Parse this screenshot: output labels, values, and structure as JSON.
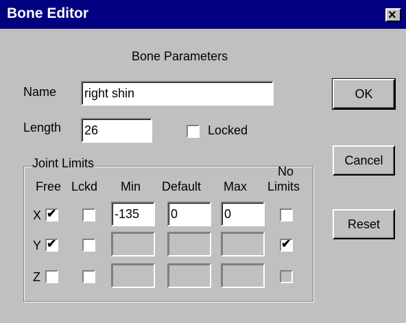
{
  "window": {
    "title": "Bone Editor",
    "close_glyph": "×"
  },
  "header": {
    "section_title": "Bone Parameters"
  },
  "name": {
    "label": "Name",
    "value": "right shin"
  },
  "length": {
    "label": "Length",
    "value": "26"
  },
  "locked": {
    "label": "Locked",
    "checked": false
  },
  "buttons": {
    "ok": "OK",
    "cancel": "Cancel",
    "reset": "Reset"
  },
  "joint_limits": {
    "title": "Joint Limits",
    "headers": {
      "free": "Free",
      "lckd": "Lckd",
      "min": "Min",
      "default": "Default",
      "max": "Max",
      "no_limits_1": "No",
      "no_limits_2": "Limits"
    },
    "rows": [
      {
        "axis": "X",
        "free": true,
        "lckd": false,
        "min": "-135",
        "default": "0",
        "max": "0",
        "no_limits": false,
        "fields_enabled": true,
        "no_limits_enabled": true
      },
      {
        "axis": "Y",
        "free": true,
        "lckd": false,
        "min": "",
        "default": "",
        "max": "",
        "no_limits": true,
        "fields_enabled": false,
        "no_limits_enabled": true
      },
      {
        "axis": "Z",
        "free": false,
        "lckd": false,
        "min": "",
        "default": "",
        "max": "",
        "no_limits": false,
        "fields_enabled": false,
        "no_limits_enabled": false
      }
    ]
  },
  "icons": {
    "check": "checkmark-icon",
    "close": "close-icon"
  }
}
